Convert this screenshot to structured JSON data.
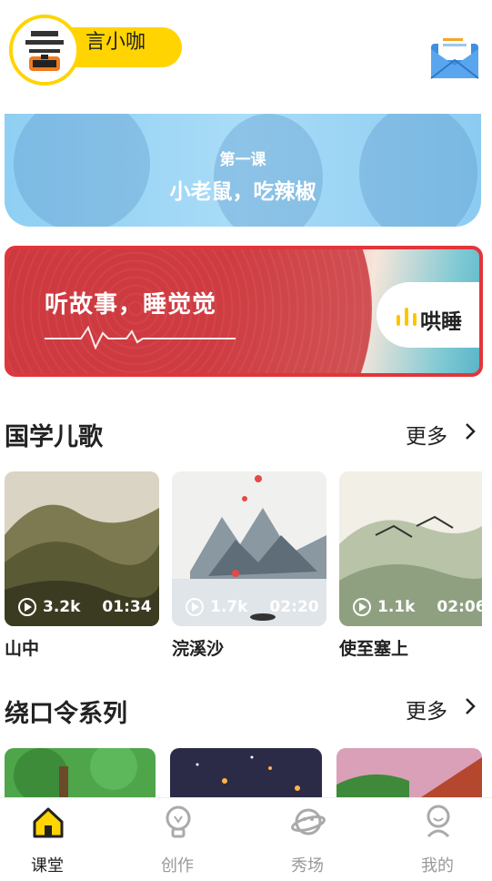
{
  "header": {
    "username": "言小咖"
  },
  "banner_lesson": {
    "subtitle": "第一课",
    "title": "小老鼠，吃辣椒"
  },
  "banner_sleep": {
    "title": "听故事，睡觉觉",
    "button_label": "哄睡"
  },
  "section_poems": {
    "title": "国学儿歌",
    "more_label": "更多",
    "items": [
      {
        "title": "山中",
        "plays": "3.2k",
        "duration": "01:34"
      },
      {
        "title": "浣溪沙",
        "plays": "1.7k",
        "duration": "02:20"
      },
      {
        "title": "使至塞上",
        "plays": "1.1k",
        "duration": "02:06"
      }
    ]
  },
  "section_tongue": {
    "title": "绕口令系列",
    "more_label": "更多"
  },
  "bottom_nav": {
    "tabs": [
      {
        "label": "课堂",
        "icon": "house-icon",
        "active": true
      },
      {
        "label": "创作",
        "icon": "lightbulb-icon",
        "active": false
      },
      {
        "label": "秀场",
        "icon": "planet-icon",
        "active": false
      },
      {
        "label": "我的",
        "icon": "person-icon",
        "active": false
      }
    ]
  },
  "colors": {
    "accent": "#ffd400",
    "banner_red": "#e2353b",
    "banner_blue": "#8fcff3",
    "inactive": "#999999"
  }
}
